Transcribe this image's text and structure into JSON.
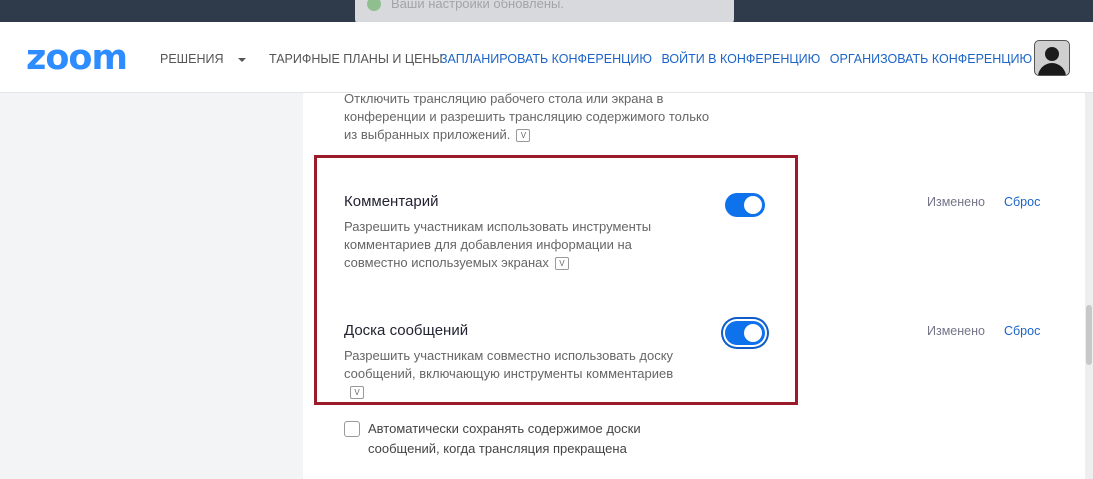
{
  "toast": {
    "message": "Ваши настройки обновлены."
  },
  "header": {
    "logo": "zoom",
    "nav_left": [
      {
        "label": "РЕШЕНИЯ"
      },
      {
        "label": "ТАРИФНЫЕ ПЛАНЫ И ЦЕНЫ"
      }
    ],
    "nav_right": [
      {
        "label": "ЗАПЛАНИРОВАТЬ КОНФЕРЕНЦИЮ"
      },
      {
        "label": "ВОЙТИ В КОНФЕРЕНЦИЮ"
      },
      {
        "label": "ОРГАНИЗОВАТЬ КОНФЕРЕНЦИЮ"
      }
    ]
  },
  "settings": {
    "prev_description": "Отключить трансляцию рабочего стола или экрана в конференции и разрешить трансляцию содержимого только из выбранных приложений.",
    "comments": {
      "title": "Комментарий",
      "description": "Разрешить участникам использовать инструменты комментариев для добавления информации на совместно используемых экранах",
      "status": "Изменено",
      "reset": "Сброс",
      "enabled": true
    },
    "whiteboard": {
      "title": "Доска сообщений",
      "description": "Разрешить участникам совместно использовать доску сообщений, включающую инструменты комментариев",
      "status": "Изменено",
      "reset": "Сброс",
      "enabled": true
    },
    "autosave": {
      "label": "Автоматически сохранять содержимое доски сообщений, когда трансляция прекращена",
      "checked": false
    }
  },
  "colors": {
    "accent": "#0e72ed",
    "brand": "#2d8cff",
    "highlight": "#9b1b2a"
  }
}
